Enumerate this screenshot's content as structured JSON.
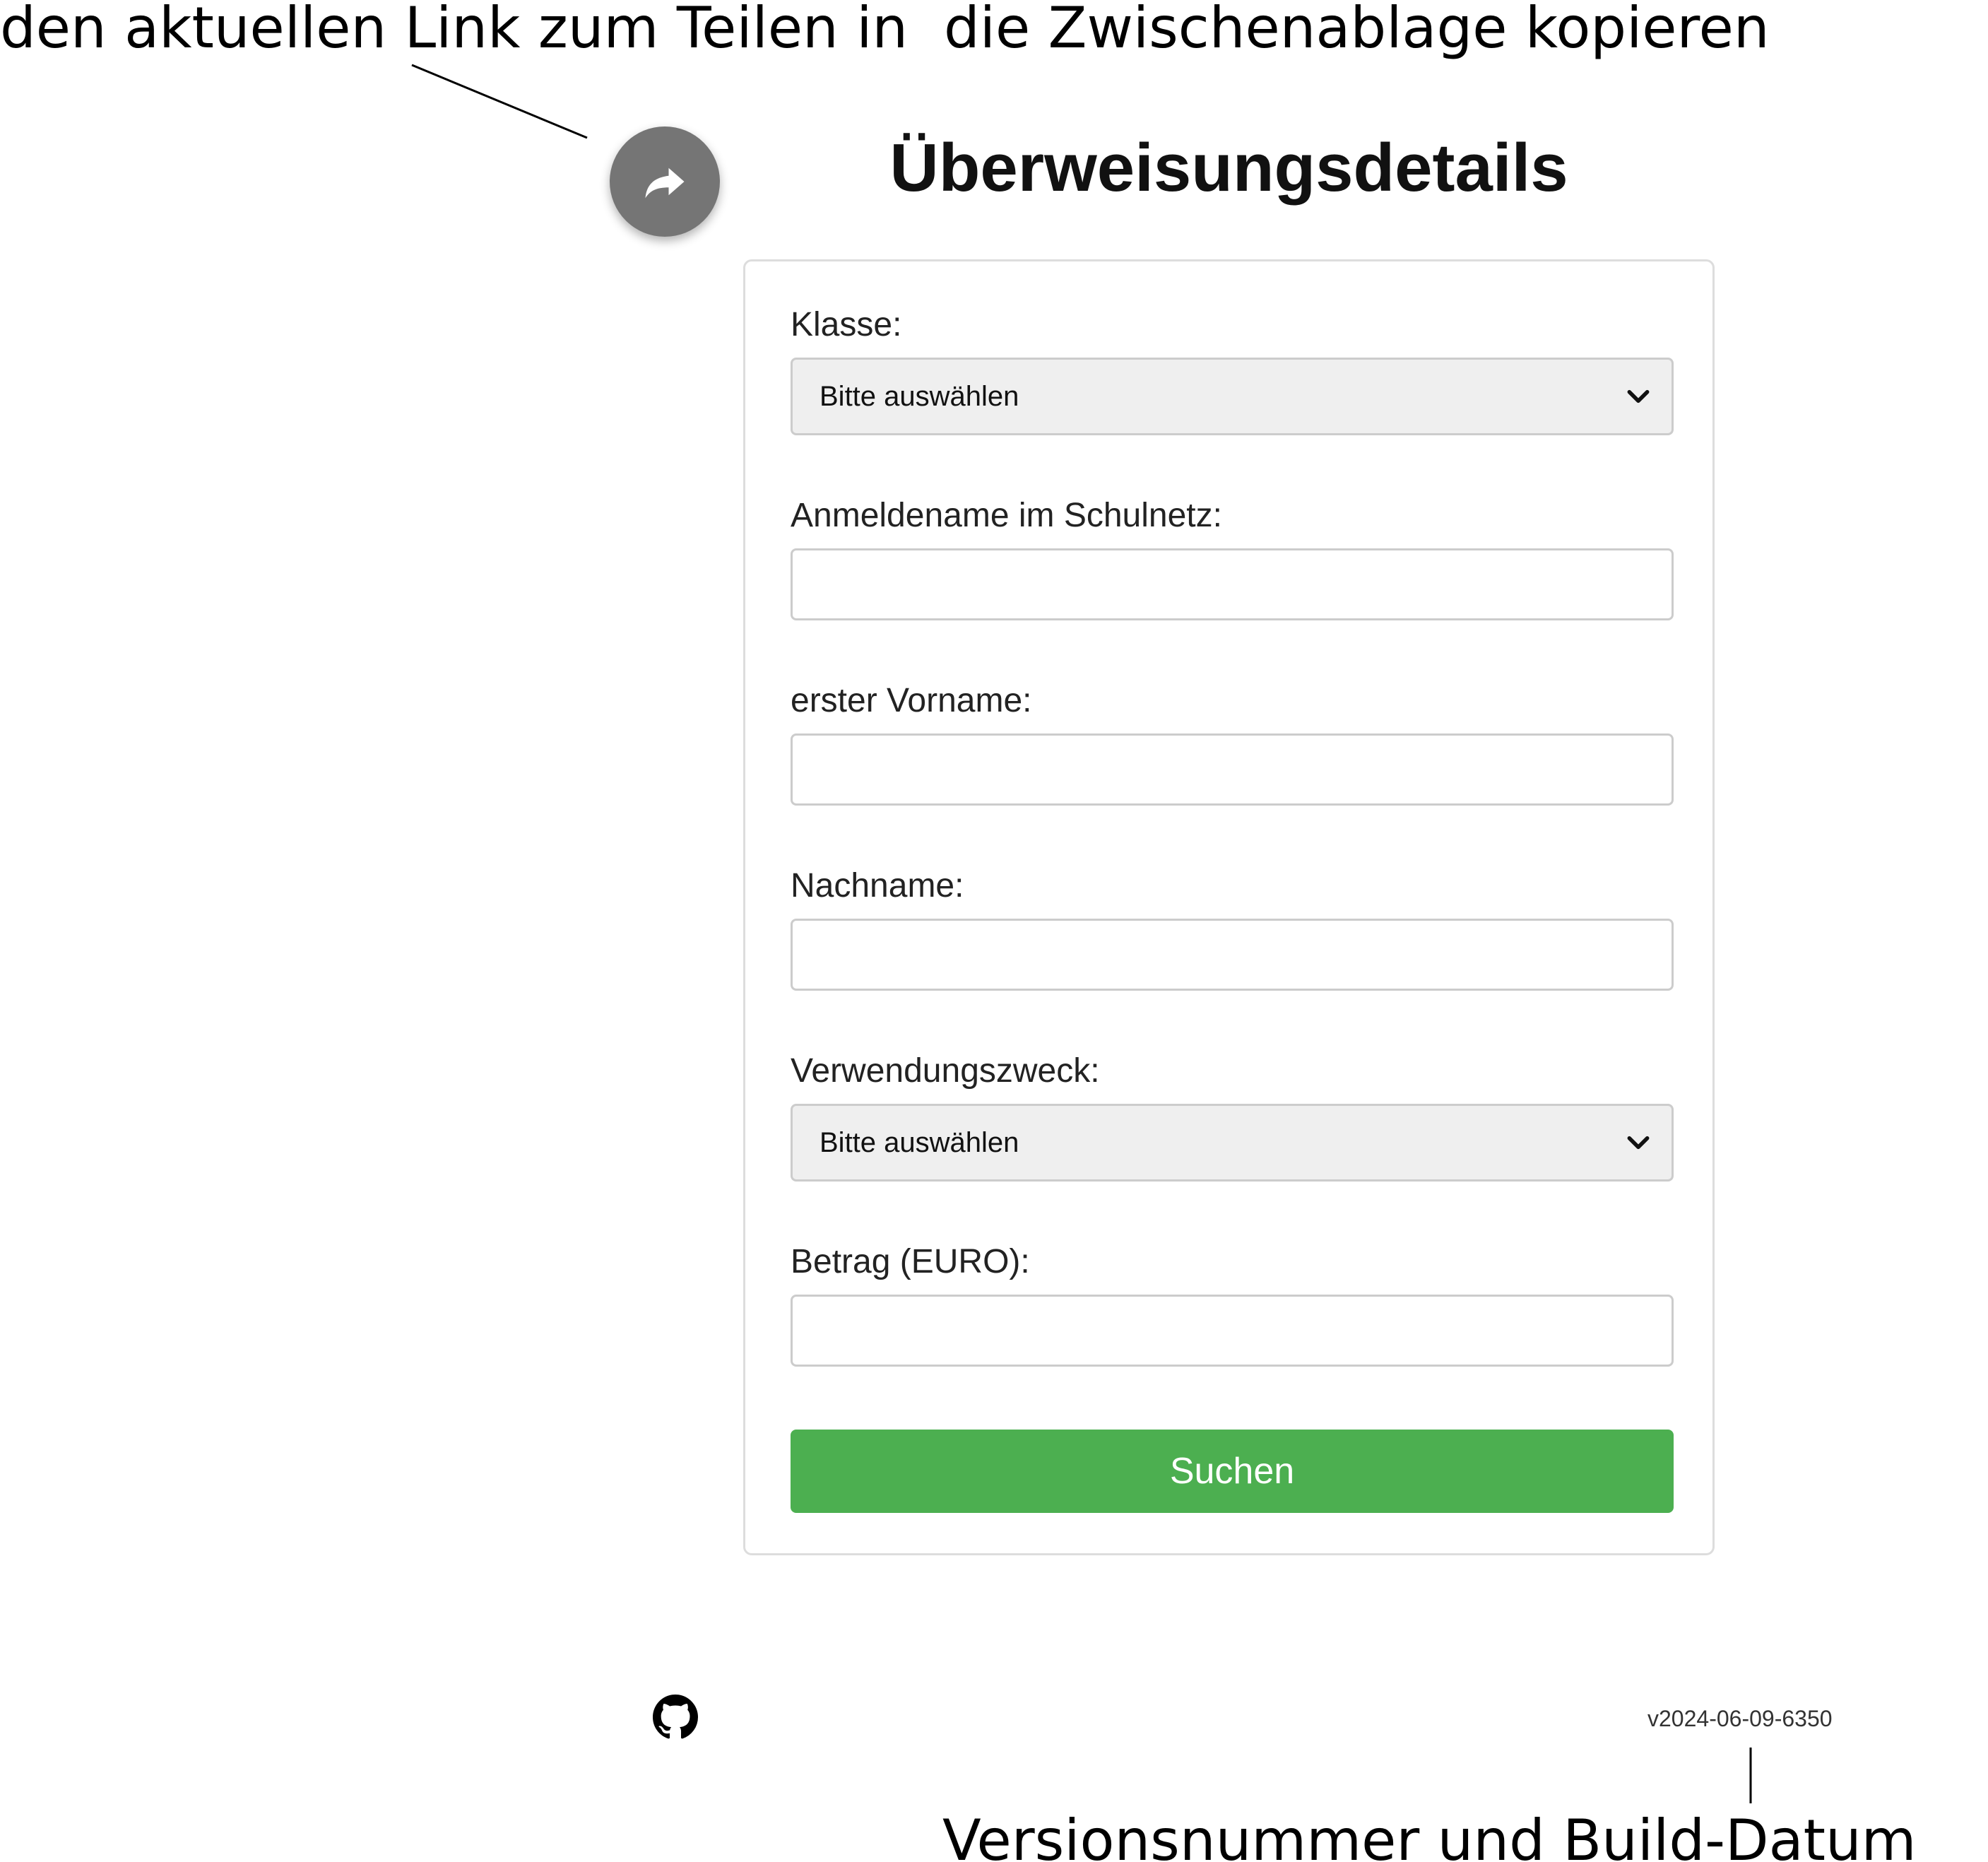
{
  "annotations": {
    "share_link": "den aktuellen Link zum Teilen in  die Zwischenablage kopieren",
    "version": "Versionsnummer und Build-Datum"
  },
  "share_button": {
    "icon": "share-arrow-icon"
  },
  "page_title": "Überweisungsdetails",
  "form": {
    "klasse": {
      "label": "Klasse:",
      "selected": "Bitte auswählen"
    },
    "anmeldename": {
      "label": "Anmeldename im Schulnetz:",
      "value": ""
    },
    "vorname": {
      "label": "erster Vorname:",
      "value": ""
    },
    "nachname": {
      "label": "Nachname:",
      "value": ""
    },
    "verwendungszweck": {
      "label": "Verwendungszweck:",
      "selected": "Bitte auswählen"
    },
    "betrag": {
      "label": "Betrag (EURO):",
      "value": ""
    },
    "submit_label": "Suchen"
  },
  "footer": {
    "github_icon": "github-icon",
    "version": "v2024-06-09-6350"
  },
  "colors": {
    "submit_button": "#4caf50",
    "share_button": "#757575",
    "select_background": "#efefef",
    "card_border": "#dddddd"
  }
}
